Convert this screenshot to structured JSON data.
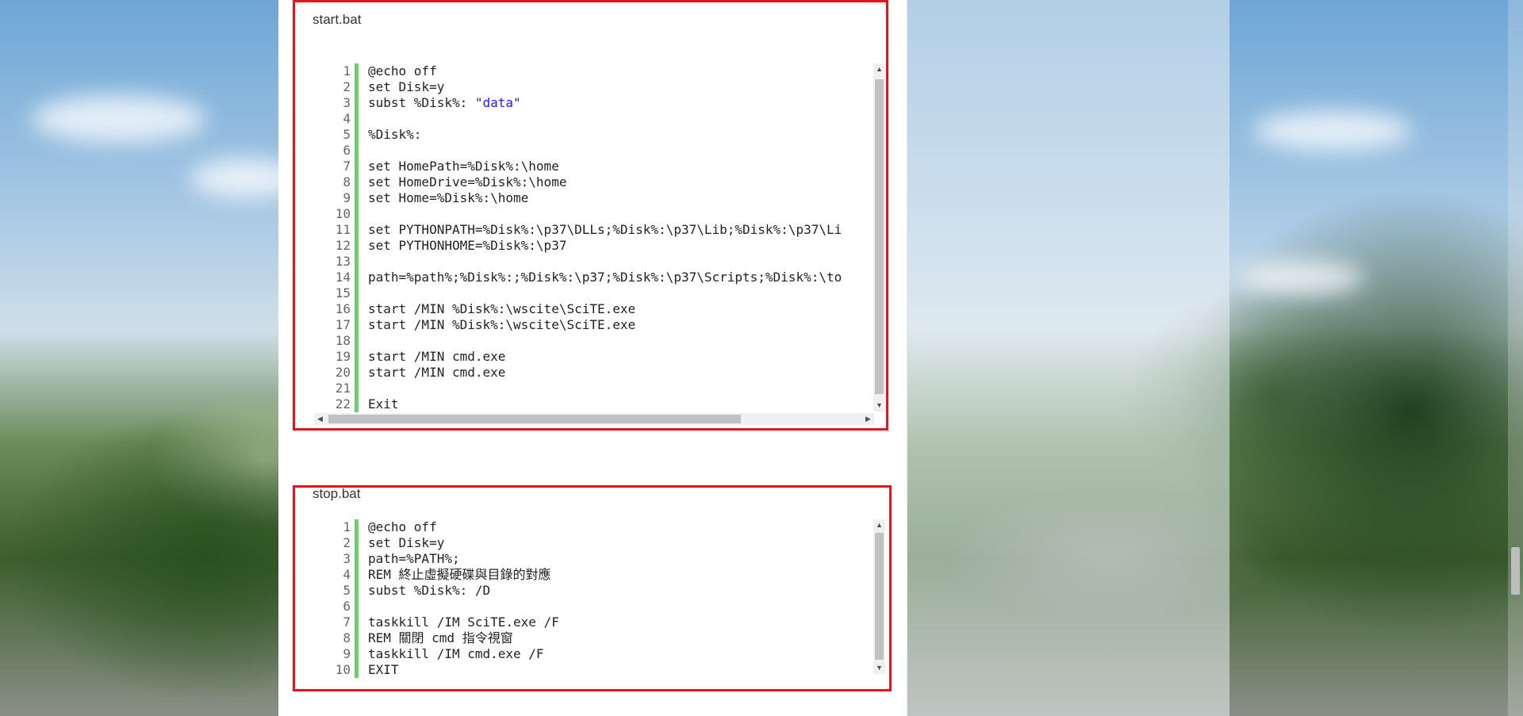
{
  "start_panel": {
    "title": "start.bat",
    "lines": [
      [
        "@echo off"
      ],
      [
        "set Disk=y"
      ],
      [
        "subst %Disk%: ",
        {
          "str": "\"data\""
        }
      ],
      [
        ""
      ],
      [
        "%Disk%:"
      ],
      [
        ""
      ],
      [
        "set HomePath=%Disk%:\\home"
      ],
      [
        "set HomeDrive=%Disk%:\\home"
      ],
      [
        "set Home=%Disk%:\\home"
      ],
      [
        ""
      ],
      [
        "set PYTHONPATH=%Disk%:\\p37\\DLLs;%Disk%:\\p37\\Lib;%Disk%:\\p37\\Li"
      ],
      [
        "set PYTHONHOME=%Disk%:\\p37"
      ],
      [
        ""
      ],
      [
        "path=%path%;%Disk%:;%Disk%:\\p37;%Disk%:\\p37\\Scripts;%Disk%:\\to"
      ],
      [
        ""
      ],
      [
        "start /MIN %Disk%:\\wscite\\SciTE.exe"
      ],
      [
        "start /MIN %Disk%:\\wscite\\SciTE.exe"
      ],
      [
        ""
      ],
      [
        "start /MIN cmd.exe"
      ],
      [
        "start /MIN cmd.exe"
      ],
      [
        ""
      ],
      [
        "Exit"
      ]
    ]
  },
  "stop_panel": {
    "title": "stop.bat",
    "lines": [
      [
        "@echo off"
      ],
      [
        "set Disk=y"
      ],
      [
        "path=%PATH%;"
      ],
      [
        "REM 終止虛擬硬碟與目錄的對應"
      ],
      [
        "subst %Disk%: /D"
      ],
      [
        ""
      ],
      [
        "taskkill /IM SciTE.exe /F"
      ],
      [
        "REM 關閉 cmd 指令視窗"
      ],
      [
        "taskkill /IM cmd.exe /F"
      ],
      [
        "EXIT"
      ]
    ]
  },
  "colors": {
    "panel_border": "#e3141b",
    "gutter_bar": "#6ccf6c",
    "string": "#1a1aff"
  },
  "icons": {
    "scroll_up": "▲",
    "scroll_down": "▼",
    "scroll_left": "◀",
    "scroll_right": "▶"
  }
}
